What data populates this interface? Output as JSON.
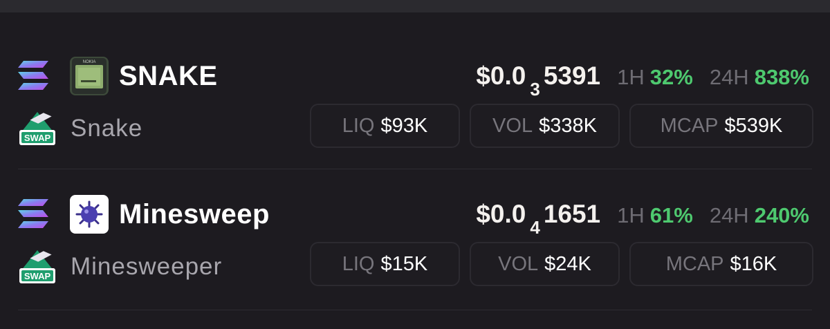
{
  "tokens": [
    {
      "symbol": "SNAKE",
      "name": "Snake",
      "price_prefix": "$0.0",
      "price_zeros": "3",
      "price_digits": "5391",
      "h1_label": "1H",
      "h1_change": "32%",
      "h24_label": "24H",
      "h24_change": "838%",
      "liq_label": "LIQ",
      "liq_value": "$93K",
      "vol_label": "VOL",
      "vol_value": "$338K",
      "mcap_label": "MCAP",
      "mcap_value": "$539K",
      "swap_label": "SWAP",
      "thumb_text": "NOKIA"
    },
    {
      "symbol": "Minesweep",
      "name": "Minesweeper",
      "price_prefix": "$0.0",
      "price_zeros": "4",
      "price_digits": "1651",
      "h1_label": "1H",
      "h1_change": "61%",
      "h24_label": "24H",
      "h24_change": "240%",
      "liq_label": "LIQ",
      "liq_value": "$15K",
      "vol_label": "VOL",
      "vol_value": "$24K",
      "mcap_label": "MCAP",
      "mcap_value": "$16K",
      "swap_label": "SWAP"
    }
  ],
  "icons": {
    "chain": "solana-icon",
    "swap": "swap-icon",
    "snake_thumb": "nokia-phone-icon",
    "mine_thumb": "mine-icon"
  },
  "colors": {
    "background": "#1d1b20",
    "positive": "#4ec96f",
    "muted_label": "#6e6c73",
    "pill_border": "#2c2a30",
    "swap_green": "#1f9e6e"
  }
}
